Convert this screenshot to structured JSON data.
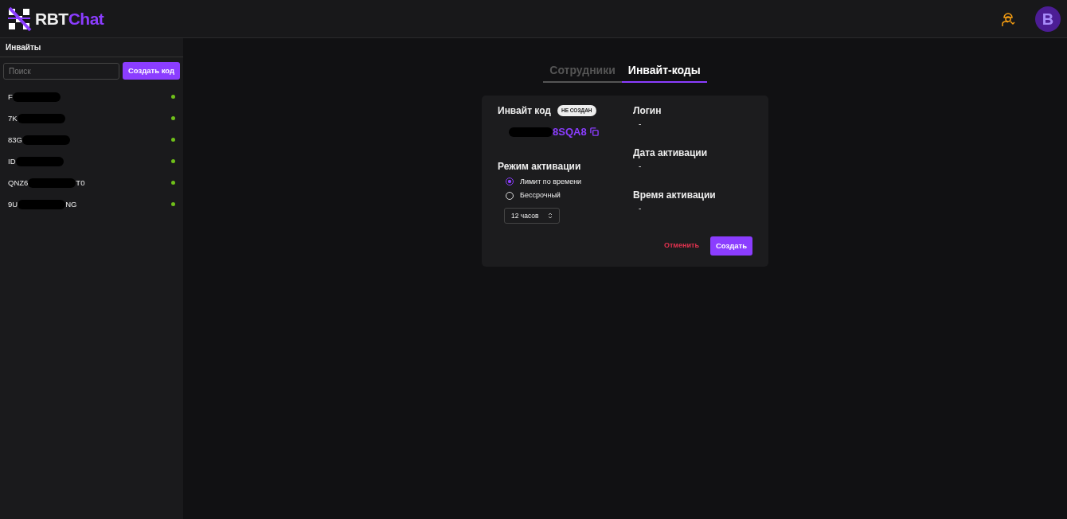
{
  "brand": {
    "first": "RBT",
    "second": "Chat"
  },
  "header": {
    "avatar": "B"
  },
  "sidebar": {
    "title": "Инвайты",
    "search": {
      "placeholder": "Поиск"
    },
    "create_button": "Создать код",
    "items": [
      {
        "prefix": "F",
        "color": "#6fbf1a"
      },
      {
        "prefix": "7K",
        "color": "#6fbf1a"
      },
      {
        "prefix": "83G",
        "color": "#6fbf1a"
      },
      {
        "prefix": "ID",
        "color": "#6fbf1a"
      },
      {
        "prefix": "QNZ6",
        "suffix": "T0",
        "color": "#6fbf1a"
      },
      {
        "prefix": "9U",
        "suffix": "NG",
        "color": "#6fbf1a"
      }
    ]
  },
  "tabs": [
    {
      "label": "Сотрудники",
      "selected": false
    },
    {
      "label": "Инвайт-коды",
      "selected": true
    }
  ],
  "invite": {
    "title": "Инвайт код",
    "badge": "НЕ СОЗДАН",
    "code_suffix": "8SQA8",
    "mode_title": "Режим активации",
    "modes": [
      {
        "label": "Лимит по времени",
        "selected": true
      },
      {
        "label": "Бессрочный",
        "selected": false
      }
    ],
    "duration": "12 часов",
    "fields": [
      {
        "label": "Логин",
        "value": "-"
      },
      {
        "label": "Дата активации",
        "value": "-"
      },
      {
        "label": "Время активации",
        "value": "-"
      }
    ],
    "cancel": "Отменить",
    "submit": "Создать"
  }
}
